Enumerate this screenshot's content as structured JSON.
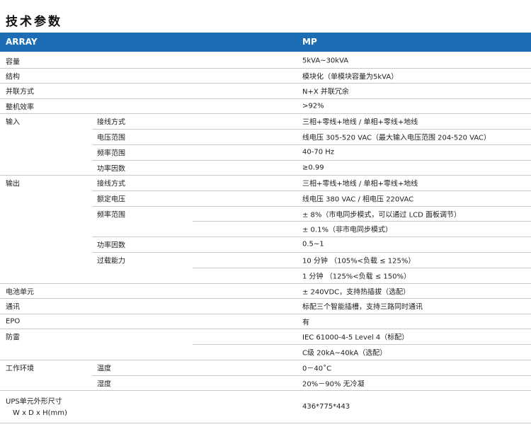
{
  "title": "技术参数",
  "header": {
    "col_left": "ARRAY",
    "col_right": "MP"
  },
  "rows": [
    {
      "c1": "容量",
      "c2": "",
      "c3": "5kVA~30kVA"
    },
    {
      "c1": "结构",
      "c2": "",
      "c3": "模块化（单模块容量为5kVA）"
    },
    {
      "c1": "并联方式",
      "c2": "",
      "c3": "N+X 并联冗余"
    },
    {
      "c1": "整机效率",
      "c2": "",
      "c3": ">92%"
    },
    {
      "c1": "输入",
      "c2": "接线方式",
      "c3": "三相+零线+地线 / 单相+零线+地线"
    },
    {
      "c1": "",
      "c2": "电压范围",
      "c3": "线电压 305-520 VAC（最大输入电压范围 204-520 VAC）"
    },
    {
      "c1": "",
      "c2": "频率范围",
      "c3": "40-70 Hz"
    },
    {
      "c1": "",
      "c2": "功率因数",
      "c3": "≥0.99"
    },
    {
      "c1": "输出",
      "c2": "接线方式",
      "c3": "三相+零线+地线 / 单相+零线+地线"
    },
    {
      "c1": "",
      "c2": "额定电压",
      "c3": "线电压 380 VAC / 相电压 220VAC"
    },
    {
      "c1": "",
      "c2": "频率范围",
      "c3": "± 8%（市电同步模式，可以通过 LCD 面板调节）"
    },
    {
      "c1": "",
      "c2": "",
      "c3": "± 0.1%（非市电同步模式）"
    },
    {
      "c1": "",
      "c2": "功率因数",
      "c3": "0.5~1"
    },
    {
      "c1": "",
      "c2": "过载能力",
      "c3": "10 分钟 （105%<负载 ≤ 125%）"
    },
    {
      "c1": "",
      "c2": "",
      "c3": "1 分钟 （125%<负载 ≤ 150%）"
    },
    {
      "c1": "电池单元",
      "c2": "",
      "c3": "± 240VDC，支持热插拔（选配）"
    },
    {
      "c1": "通讯",
      "c2": "",
      "c3": "标配三个智能插槽，支持三路同时通讯"
    },
    {
      "c1": "EPO",
      "c2": "",
      "c3": "有"
    },
    {
      "c1": "防雷",
      "c2": "",
      "c3": "IEC 61000-4-5 Level 4（标配）"
    },
    {
      "c1": "",
      "c2": "",
      "c3": "C级 20kA~40kA（选配）"
    },
    {
      "c1": "工作环境",
      "c2": "温度",
      "c3": "0－40˚C"
    },
    {
      "c1": "",
      "c2": "湿度",
      "c3": "20%－90% 无冷凝"
    }
  ],
  "ups": {
    "label_line1": "UPS单元外形尺寸",
    "label_line2": "W x D x H(mm)",
    "value": "436*775*443"
  }
}
